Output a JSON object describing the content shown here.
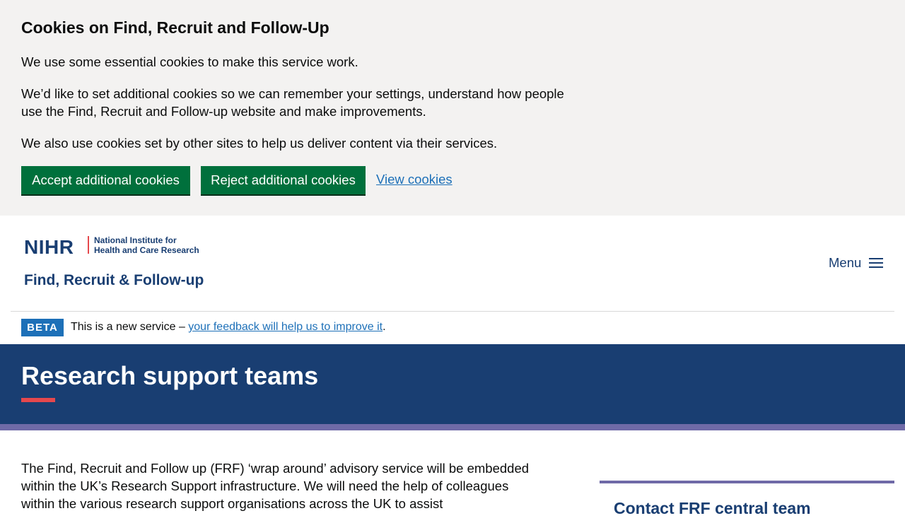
{
  "cookie_banner": {
    "title": "Cookies on Find, Recruit and Follow-Up",
    "p1": "We use some essential cookies to make this service work.",
    "p2": "We’d like to set additional cookies so we can remember your settings, understand how people use the Find, Recruit and Follow-up website and make improvements.",
    "p3": "We also use cookies set by other sites to help us deliver content via their services.",
    "accept_label": "Accept additional cookies",
    "reject_label": "Reject additional cookies",
    "view_label": "View cookies"
  },
  "header": {
    "logo_text": "NIHR",
    "logo_sub_line1": "National Institute for",
    "logo_sub_line2": "Health and Care Research",
    "service_name": "Find, Recruit & Follow-up",
    "menu_label": "Menu",
    "menu_icon": "hamburger-icon"
  },
  "beta": {
    "tag": "BETA",
    "text_prefix": "This is a new service – ",
    "link_text": "your feedback will help us to improve it",
    "text_suffix": "."
  },
  "hero": {
    "title": "Research support teams"
  },
  "main": {
    "intro": "The Find, Recruit and Follow up (FRF) ‘wrap around’ advisory service will be embedded within the UK’s Research Support infrastructure. We will need the help of colleagues within the various research support organisations across the UK to assist"
  },
  "sidebar": {
    "title": "Contact FRF central team"
  },
  "colors": {
    "nihr_blue": "#193e72",
    "button_green": "#00703c",
    "link_blue": "#1d70b8",
    "accent_red": "#e5484d",
    "stripe_purple": "#6f6aa7",
    "banner_grey": "#f3f2f1"
  }
}
